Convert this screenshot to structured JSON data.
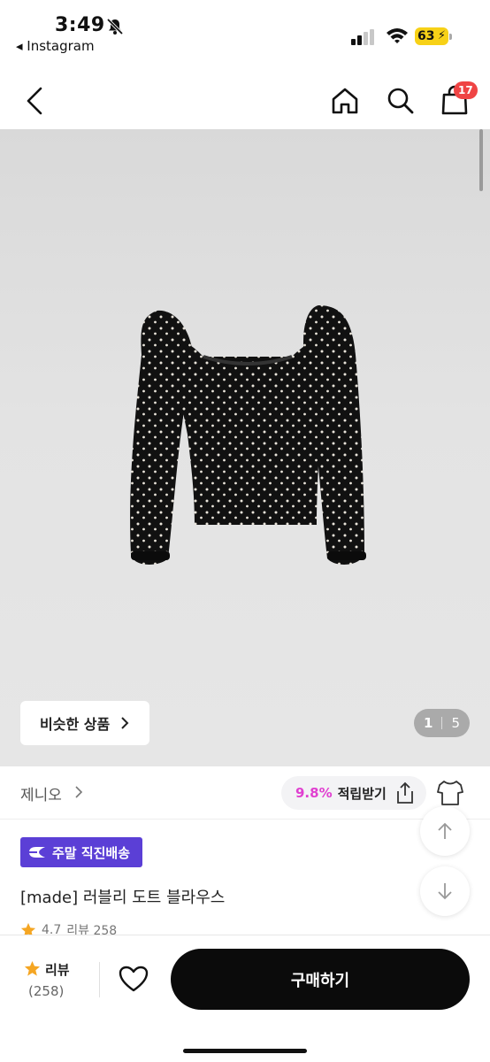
{
  "status_bar": {
    "time": "3:49",
    "back_app": "◂ Instagram",
    "battery": "63"
  },
  "nav": {
    "cart_count": "17"
  },
  "gallery": {
    "similar_label": "비슷한 상품",
    "current_page": "1",
    "total_pages": "5"
  },
  "brand": {
    "name": "제니오",
    "points_percent": "9.8%",
    "points_label": "적립받기"
  },
  "product": {
    "delivery_badge": "주말 직진배송",
    "title": "[made] 러블리 도트 블라우스",
    "rating": "4.7",
    "review_text": "리뷰 258"
  },
  "bottom": {
    "review_label": "리뷰",
    "review_count": "(258)",
    "buy_label": "구매하기"
  },
  "colors": {
    "accent_purple": "#5b3fd6",
    "points_pink": "#e040d0",
    "badge_red": "#ef4444",
    "star": "#f5a623"
  }
}
